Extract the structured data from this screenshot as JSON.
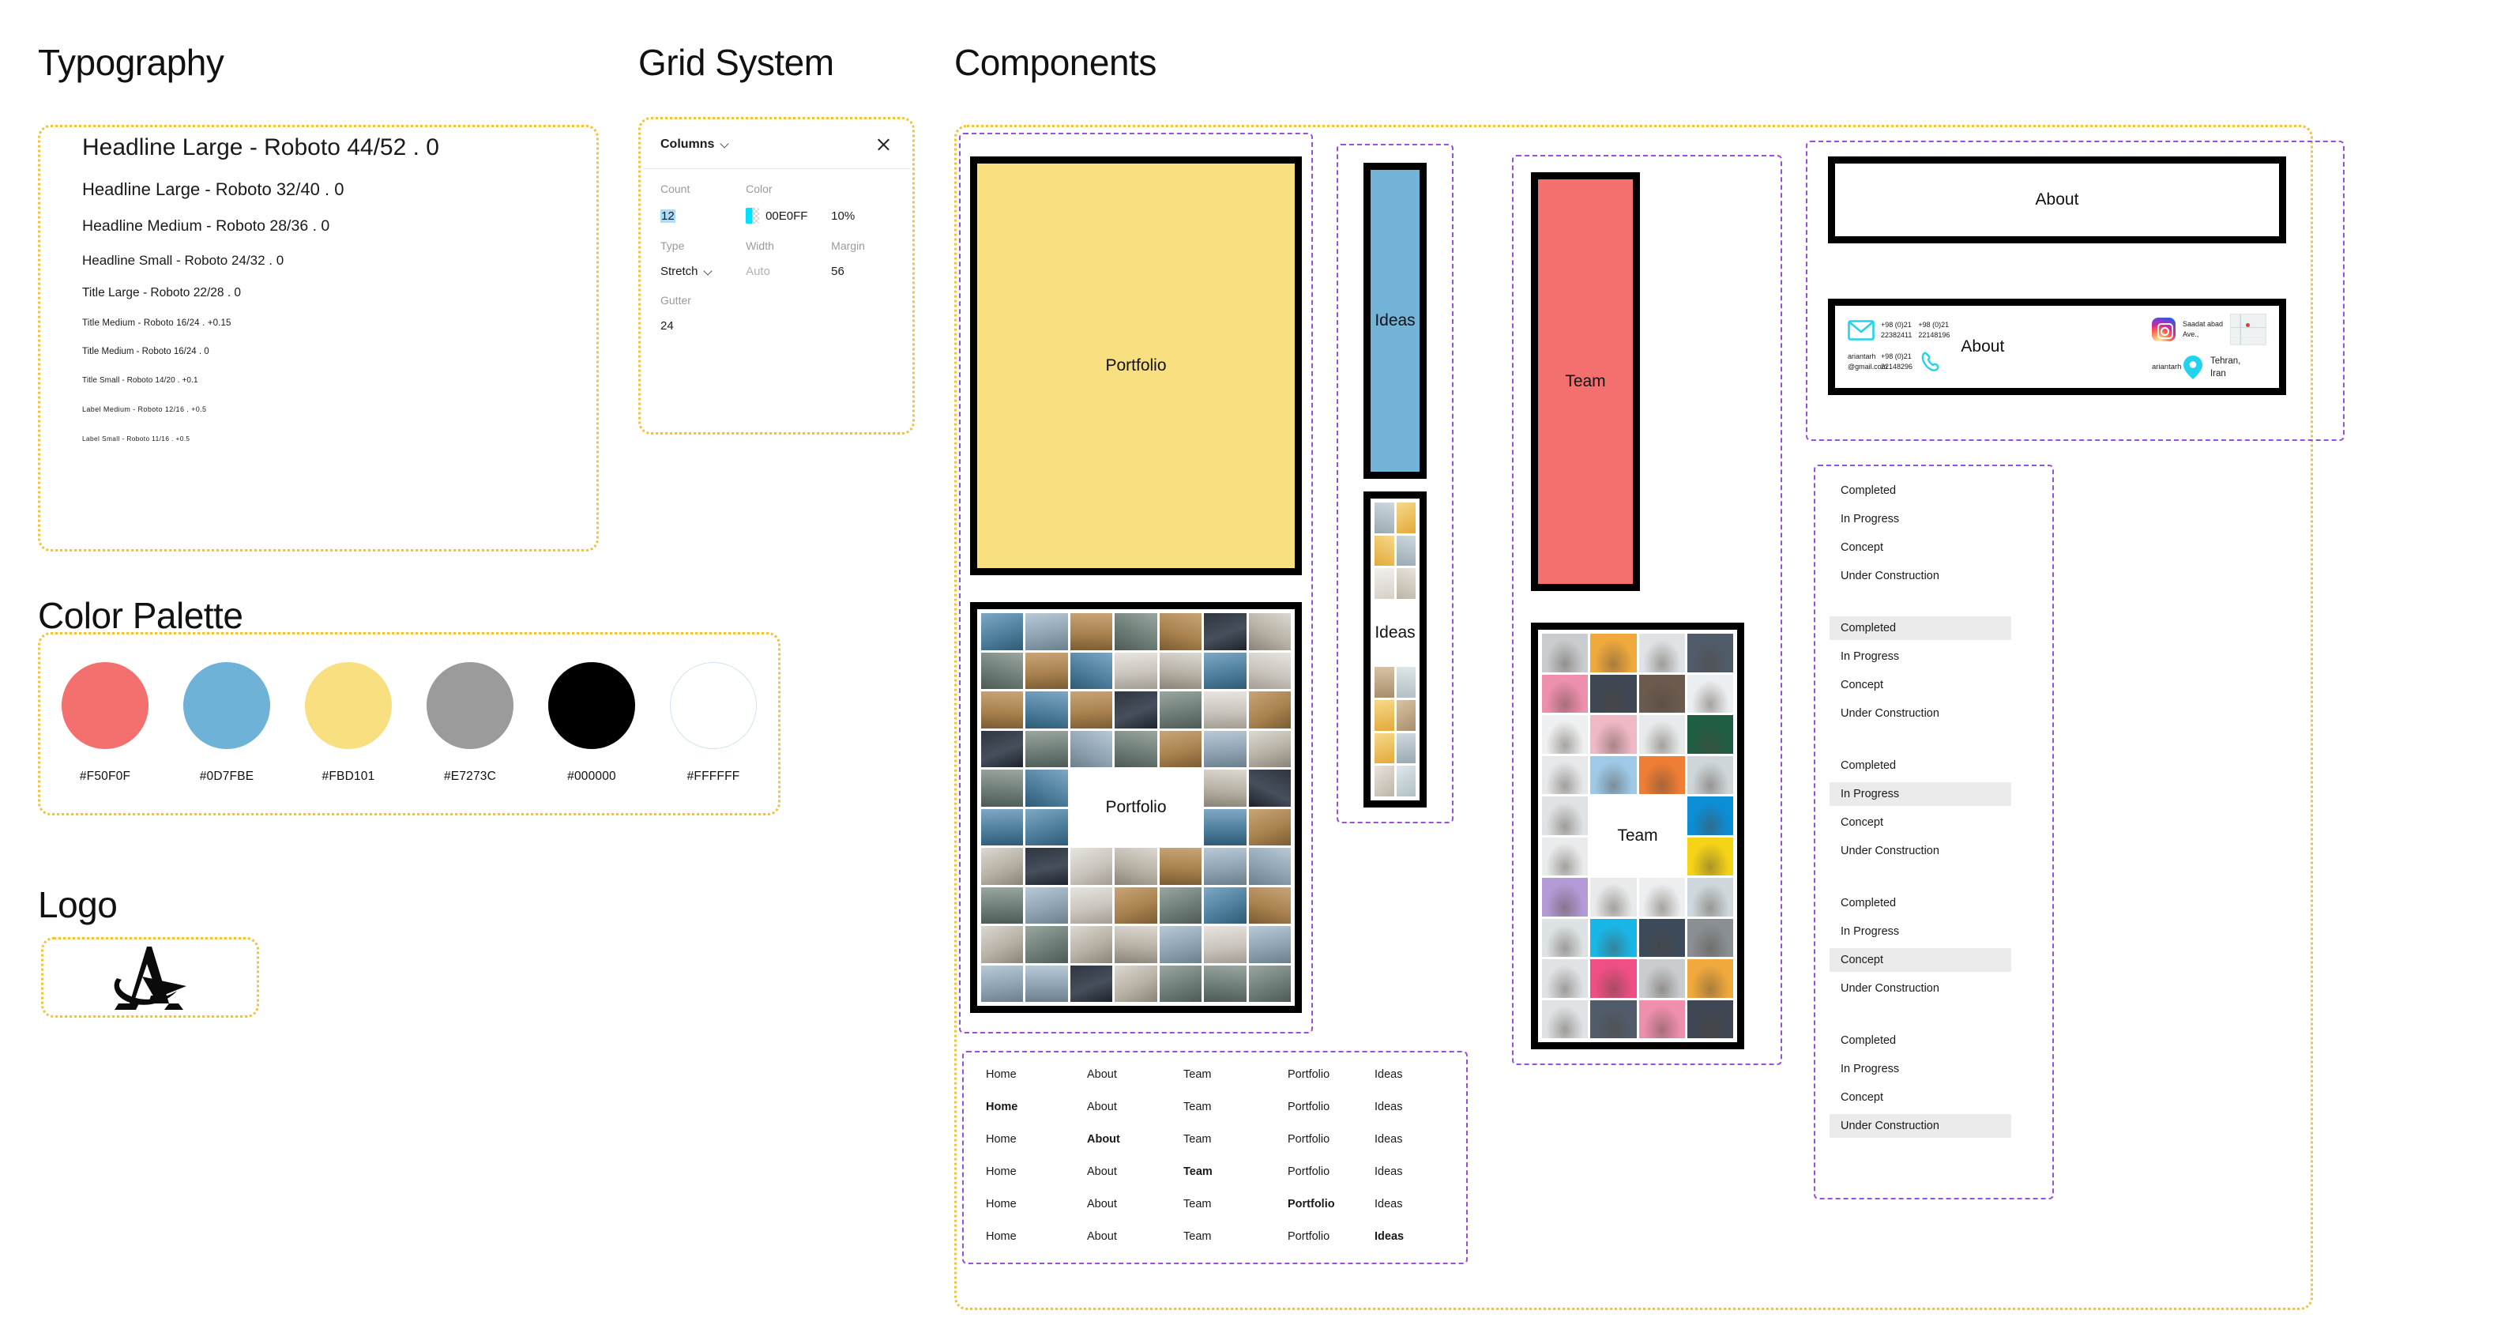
{
  "sections": {
    "typography": "Typography",
    "grid_system": "Grid System",
    "components": "Components",
    "color_palette": "Color Palette",
    "logo": "Logo"
  },
  "typography": {
    "styles": [
      "Headline Large - Roboto 44/52 . 0",
      "Headline Large - Roboto 32/40 . 0",
      "Headline Medium - Roboto 28/36 . 0",
      "Headline Small - Roboto 24/32 . 0",
      "Title Large - Roboto 22/28 . 0",
      "Title Medium - Roboto 16/24 . +0.15",
      "Title Medium - Roboto 16/24 . 0",
      "Title Small - Roboto 14/20 . +0.1",
      "Label Medium - Roboto 12/16 . +0.5",
      "Label Small - Roboto 11/16 . +0.5"
    ]
  },
  "grid_panel": {
    "title": "Columns",
    "close_label": "",
    "labels": {
      "count": "Count",
      "color": "Color",
      "type": "Type",
      "width": "Width",
      "margin": "Margin",
      "gutter": "Gutter"
    },
    "values": {
      "count": "12",
      "color_hex": "00E0FF",
      "color_opacity": "10%",
      "type": "Stretch",
      "width": "Auto",
      "margin": "56",
      "gutter": "24"
    }
  },
  "palette": {
    "swatches": [
      {
        "label": "#F50F0F",
        "fill": "#F4706E"
      },
      {
        "label": "#0D7FBE",
        "fill": "#6FB2D8"
      },
      {
        "label": "#FBD101",
        "fill": "#F8DF7F"
      },
      {
        "label": "#E7273C",
        "fill": "#9B9B9B"
      },
      {
        "label": "#000000",
        "fill": "#000000"
      },
      {
        "label": "#FFFFFF",
        "fill": "#FFFFFF"
      }
    ]
  },
  "components": {
    "portfolio_label": "Portfolio",
    "ideas_label": "Ideas",
    "team_label": "Team",
    "about_label": "About"
  },
  "about_contact": {
    "email": "ariantarh\n@gmail.com",
    "email_line1": "ariantarh",
    "email_line2": "@gmail.com",
    "phone1_line1": "+98 (0)21",
    "phone1_line2": "22382411",
    "phone2_line1": "+98 (0)21",
    "phone2_line2": "22148196",
    "phone3_line1": "+98 (0)21",
    "phone3_line2": "22148296",
    "title": "About",
    "instagram_handle": "ariantarh",
    "address_line1": "Saadat abad",
    "address_line2": "Ave.,",
    "city_line1": "Tehran,",
    "city_line2": "Iran"
  },
  "status_groups": [
    {
      "items": [
        {
          "label": "Completed",
          "active": false
        },
        {
          "label": "In Progress",
          "active": false
        },
        {
          "label": "Concept",
          "active": false
        },
        {
          "label": "Under Construction",
          "active": false
        }
      ]
    },
    {
      "items": [
        {
          "label": "Completed",
          "active": true
        },
        {
          "label": "In Progress",
          "active": false
        },
        {
          "label": "Concept",
          "active": false
        },
        {
          "label": "Under Construction",
          "active": false
        }
      ]
    },
    {
      "items": [
        {
          "label": "Completed",
          "active": false
        },
        {
          "label": "In Progress",
          "active": true
        },
        {
          "label": "Concept",
          "active": false
        },
        {
          "label": "Under Construction",
          "active": false
        }
      ]
    },
    {
      "items": [
        {
          "label": "Completed",
          "active": false
        },
        {
          "label": "In Progress",
          "active": false
        },
        {
          "label": "Concept",
          "active": true
        },
        {
          "label": "Under Construction",
          "active": false
        }
      ]
    },
    {
      "items": [
        {
          "label": "Completed",
          "active": false
        },
        {
          "label": "In Progress",
          "active": false
        },
        {
          "label": "Concept",
          "active": false
        },
        {
          "label": "Under Construction",
          "active": true
        }
      ]
    }
  ],
  "nav_menu": {
    "items": [
      "Home",
      "About",
      "Team",
      "Portfolio",
      "Ideas"
    ],
    "rows": [
      {
        "active": -1
      },
      {
        "active": 0
      },
      {
        "active": 1
      },
      {
        "active": 2
      },
      {
        "active": 3
      },
      {
        "active": 4
      }
    ]
  },
  "collages": {
    "portfolio": {
      "columns": 7,
      "rows": 10,
      "label_row": 5,
      "label_col_start": 3,
      "label_col_span": 3,
      "label_row_span": 2,
      "tones": [
        "#d8d3cb",
        "#e4e2e6",
        "#9fb0a6",
        "#8f9699",
        "#2c3440",
        "#c9a municip",
        "#b08968"
      ]
    },
    "ideas": {
      "columns": 2,
      "rows": 9,
      "label_row": 4,
      "label_row_span": 2
    },
    "team": {
      "columns": 4,
      "rows": 10,
      "label_row": 5,
      "label_col_start": 2,
      "label_col_span": 2,
      "label_row_span": 2
    }
  }
}
